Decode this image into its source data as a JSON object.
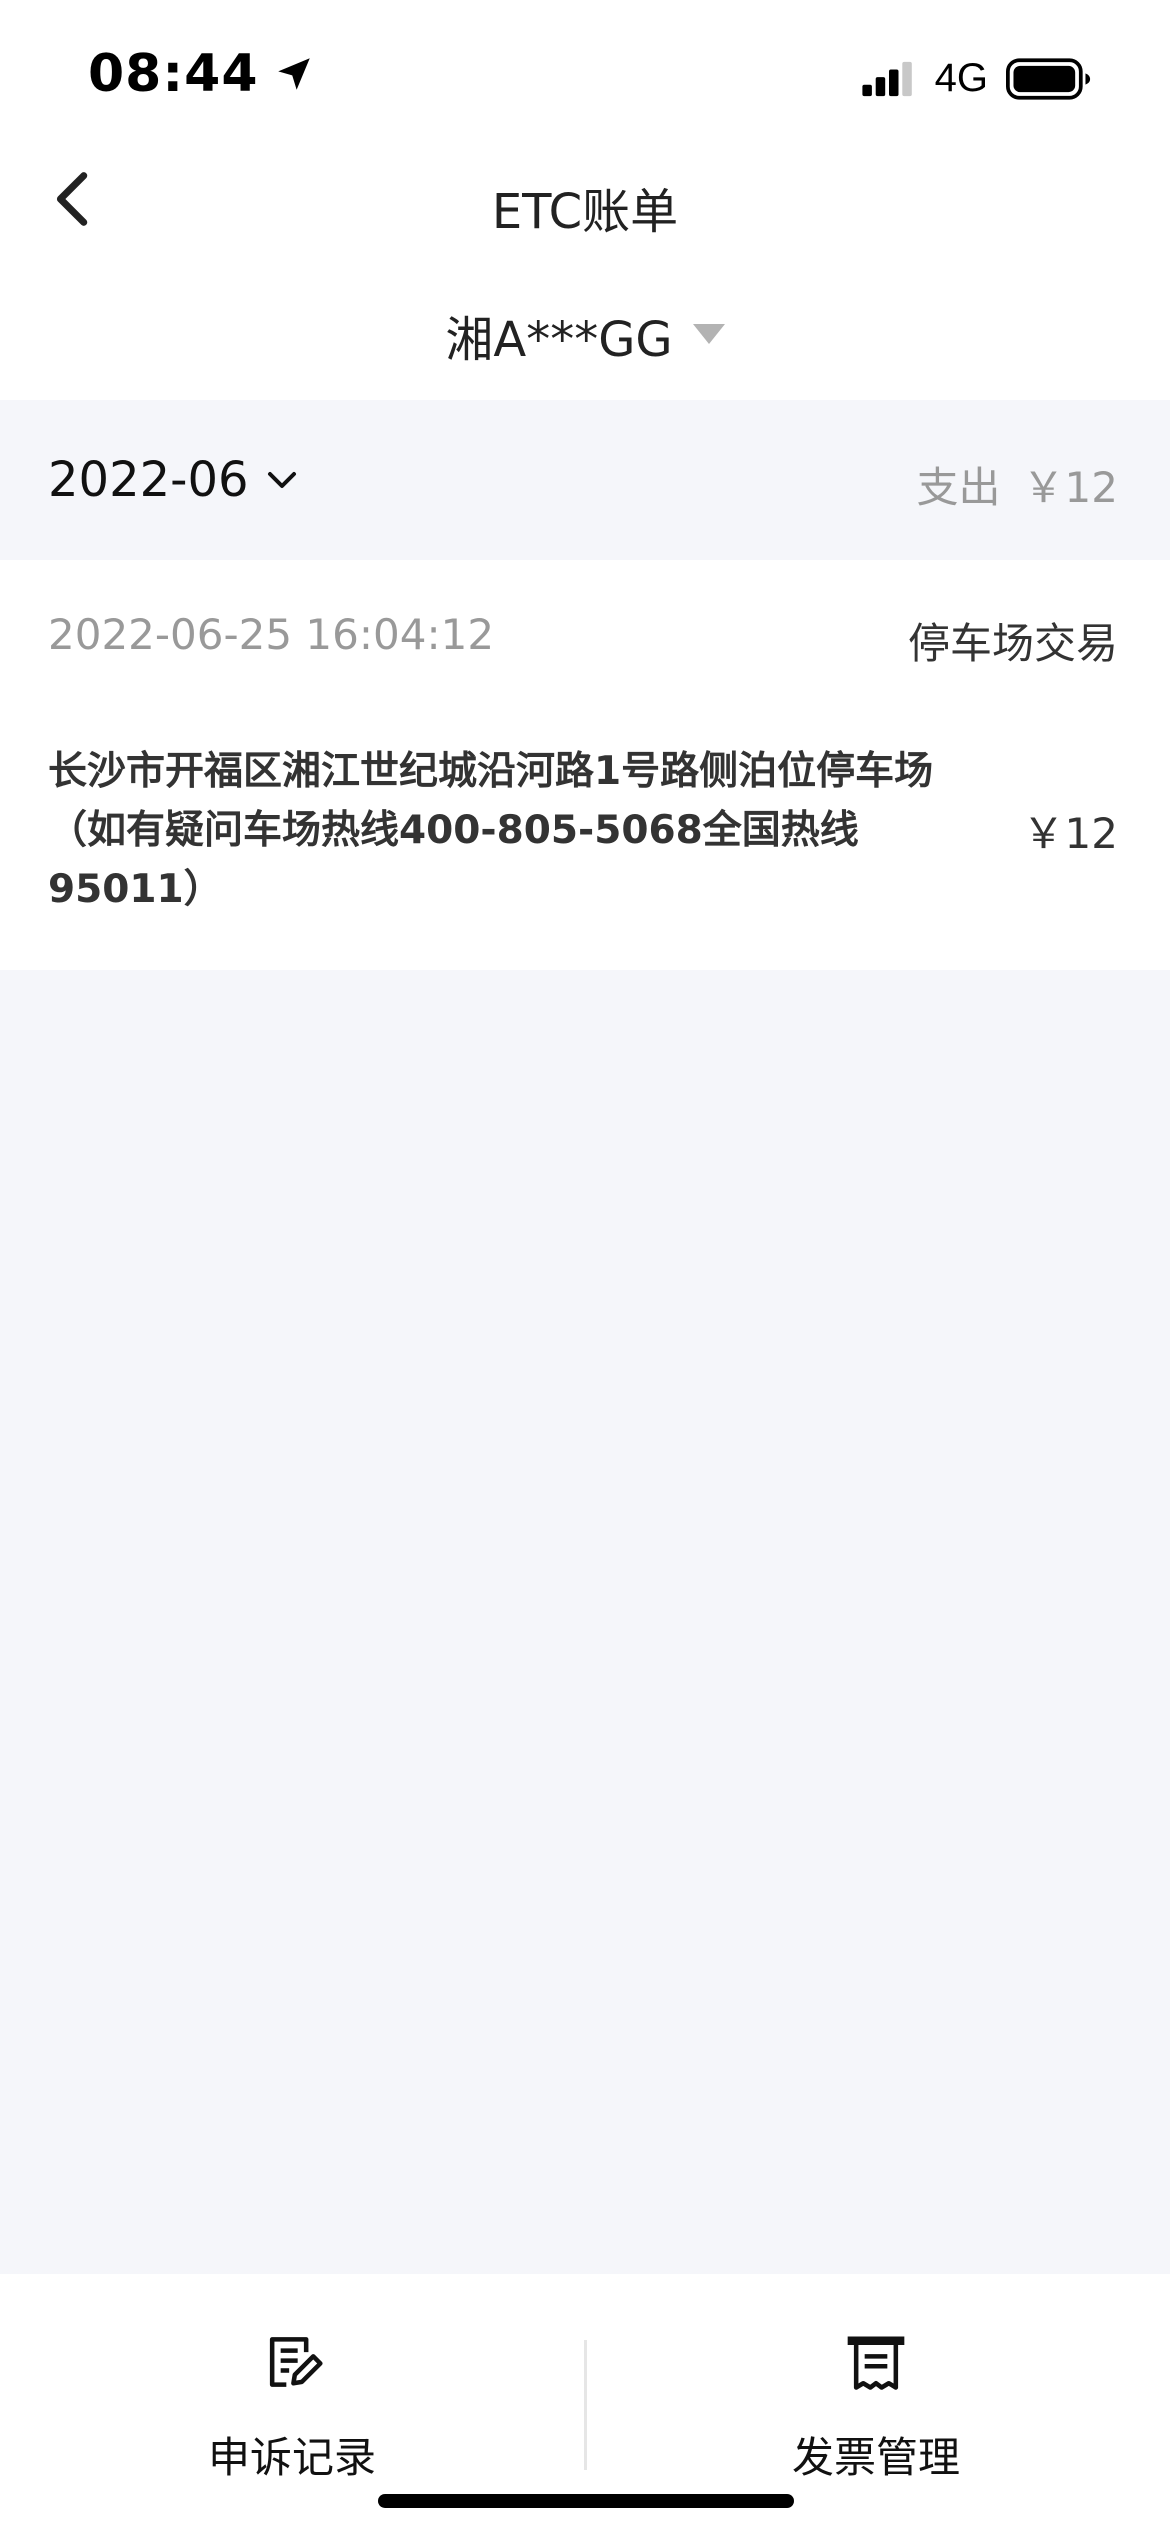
{
  "status_bar": {
    "time": "08:44",
    "network": "4G"
  },
  "header": {
    "title": "ETC账单",
    "plate": "湘A***GG"
  },
  "month_section": {
    "month": "2022-06",
    "summary_label": "支出",
    "summary_amount": "￥12"
  },
  "transactions": [
    {
      "time": "2022-06-25 16:04:12",
      "type": "停车场交易",
      "description": "长沙市开福区湘江世纪城沿河路1号路侧泊位停车场（如有疑问车场热线400-805-5068全国热线95011）",
      "amount": "￥12"
    }
  ],
  "bottom_bar": {
    "complaint_label": "申诉记录",
    "invoice_label": "发票管理"
  },
  "icons": {
    "location": "location-arrow-icon",
    "signal": "cellular-signal-icon",
    "battery": "battery-icon",
    "back": "chevron-left-icon",
    "plate_caret": "caret-down-icon",
    "month_chevron": "chevron-down-icon",
    "complaint": "edit-document-icon",
    "invoice": "receipt-icon"
  }
}
